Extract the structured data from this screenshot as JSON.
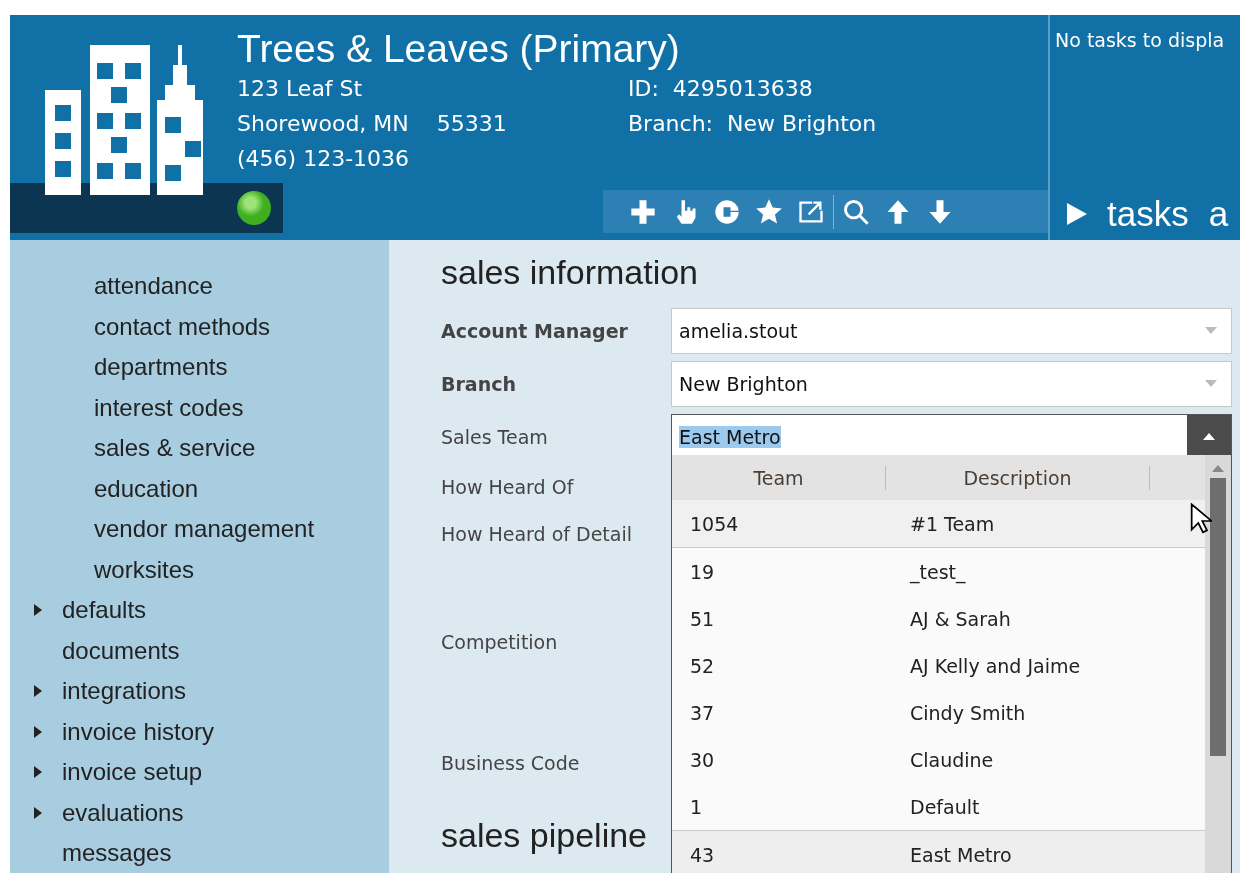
{
  "header": {
    "title": "Trees & Leaves (Primary)",
    "address_lines": [
      "123 Leaf St",
      "Shorewood, MN    55331",
      "(456) 123-1036"
    ],
    "id_label": "ID:",
    "id_value": "4295013638",
    "branch_label": "Branch:",
    "branch_value": "New Brighton",
    "status": {
      "color": "#3fae1f"
    },
    "toolbar": [
      {
        "kind": "plus"
      },
      {
        "kind": "pointer"
      },
      {
        "kind": "blob"
      },
      {
        "kind": "star"
      },
      {
        "kind": "external"
      },
      {
        "kind": "divider"
      },
      {
        "kind": "search"
      },
      {
        "kind": "up"
      },
      {
        "kind": "down"
      }
    ]
  },
  "tasks_panel": {
    "message": "No tasks to displa",
    "tab": "tasks",
    "next_tab": "a"
  },
  "sidebar": {
    "sub_items": [
      "attendance",
      "contact methods",
      "departments",
      "interest codes",
      "sales & service",
      "education",
      "vendor management",
      "worksites"
    ],
    "items": [
      {
        "label": "defaults",
        "expandable": true
      },
      {
        "label": "documents",
        "expandable": false
      },
      {
        "label": "integrations",
        "expandable": true
      },
      {
        "label": "invoice history",
        "expandable": true
      },
      {
        "label": "invoice setup",
        "expandable": true
      },
      {
        "label": "evaluations",
        "expandable": true
      },
      {
        "label": "messages",
        "expandable": false
      }
    ]
  },
  "section_title": "sales information",
  "fields": [
    {
      "label": "Account Manager",
      "bold": true,
      "kind": "select",
      "value": "amelia.stout"
    },
    {
      "label": "Branch",
      "bold": true,
      "kind": "select",
      "value": "New Brighton"
    },
    {
      "label": "Sales Team",
      "bold": false,
      "kind": "combo",
      "value": "East Metro"
    },
    {
      "label": "How Heard Of",
      "bold": false,
      "kind": "covered"
    },
    {
      "label": "How Heard of Detail",
      "bold": false,
      "kind": "covered"
    },
    {
      "label": "Competition",
      "bold": false,
      "kind": "area"
    },
    {
      "label": "Business Code",
      "bold": false,
      "kind": "area"
    }
  ],
  "next_section_title": "sales pipeline",
  "dropdown": {
    "columns": [
      "Team",
      "Description"
    ],
    "rows": [
      {
        "team": "1054",
        "description": "#1 Team",
        "hovered": true,
        "selected": false
      },
      {
        "team": "19",
        "description": "_test_",
        "hovered": false,
        "selected": false
      },
      {
        "team": "51",
        "description": "AJ & Sarah",
        "hovered": false,
        "selected": false
      },
      {
        "team": "52",
        "description": "AJ Kelly and Jaime",
        "hovered": false,
        "selected": false
      },
      {
        "team": "37",
        "description": "Cindy Smith",
        "hovered": false,
        "selected": false
      },
      {
        "team": "30",
        "description": "Claudine",
        "hovered": false,
        "selected": false
      },
      {
        "team": "1",
        "description": "Default",
        "hovered": false,
        "selected": false
      },
      {
        "team": "43",
        "description": "East Metro",
        "hovered": false,
        "selected": true
      }
    ]
  }
}
